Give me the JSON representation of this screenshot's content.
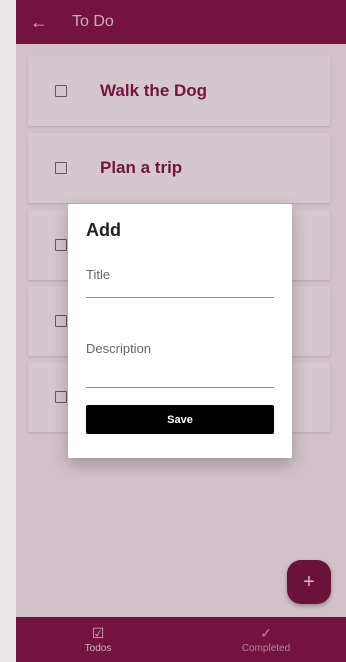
{
  "app_bar": {
    "back_icon": "arrow-left-icon",
    "title": "To Do"
  },
  "todos": [
    {
      "label": "Walk the Dog",
      "checked": false
    },
    {
      "label": "Plan a trip",
      "checked": false
    },
    {
      "label": "",
      "checked": false
    },
    {
      "label": "",
      "checked": false
    },
    {
      "label": "",
      "checked": false
    }
  ],
  "dialog": {
    "title": "Add",
    "title_field": {
      "placeholder": "Title",
      "value": ""
    },
    "description_field": {
      "placeholder": "Description",
      "value": ""
    },
    "save_label": "Save"
  },
  "fab": {
    "label": "+",
    "icon": "plus-icon"
  },
  "bottom_nav": {
    "tabs": [
      {
        "label": "Todos",
        "icon": "checklist-icon",
        "active": true
      },
      {
        "label": "Completed",
        "icon": "check-icon",
        "active": false
      }
    ]
  },
  "colors": {
    "primary": "#7a1440",
    "fab": "#6a1238",
    "surface": "#ebe6e8"
  }
}
